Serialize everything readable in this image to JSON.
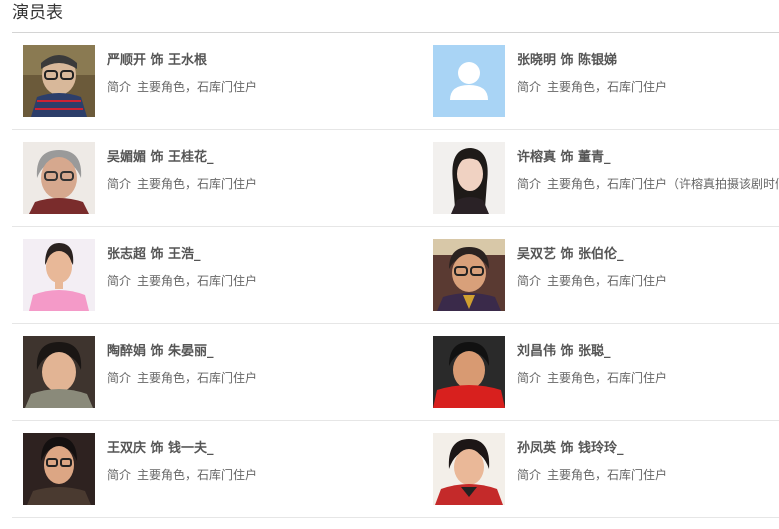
{
  "section_title": "演员表",
  "intro_label": "简介",
  "cast": [
    {
      "name": "严顺开 饰 王水根",
      "desc": "主要角色，石库门住户",
      "photo": "elderly-man-glasses"
    },
    {
      "name": "张晓明 饰 陈银娣",
      "desc": "主要角色，石库门住户",
      "photo": "default-avatar"
    },
    {
      "name": "吴媚媚 饰 王桂花_",
      "desc": "主要角色，石库门住户",
      "photo": "elderly-woman-glasses"
    },
    {
      "name": "许榕真 饰 董青_",
      "desc": "主要角色，石库门住户（许榕真拍摄该剧时们",
      "photo": "young-woman"
    },
    {
      "name": "张志超 饰 王浩_",
      "desc": "主要角色，石库门住户",
      "photo": "young-man-pink"
    },
    {
      "name": "吴双艺 饰 张伯伦_",
      "desc": "主要角色，石库门住户",
      "photo": "older-man-glasses"
    },
    {
      "name": "陶醉娟 饰 朱晏丽_",
      "desc": "主要角色，石库门住户",
      "photo": "middle-aged-woman"
    },
    {
      "name": "刘昌伟 饰 张聪_",
      "desc": "主要角色，石库门住户",
      "photo": "man-red-shirt"
    },
    {
      "name": "王双庆 饰 钱一夫_",
      "desc": "主要角色，石库门住户",
      "photo": "old-man-dark"
    },
    {
      "name": "孙凤英 饰 钱玲玲_",
      "desc": "主要角色，石库门住户",
      "photo": "woman-red-jacket"
    }
  ],
  "colors": {
    "name_text": "#555555",
    "desc_text": "#666666",
    "divider": "#e6e6e6",
    "avatar_bg": "#a9d4f5"
  }
}
